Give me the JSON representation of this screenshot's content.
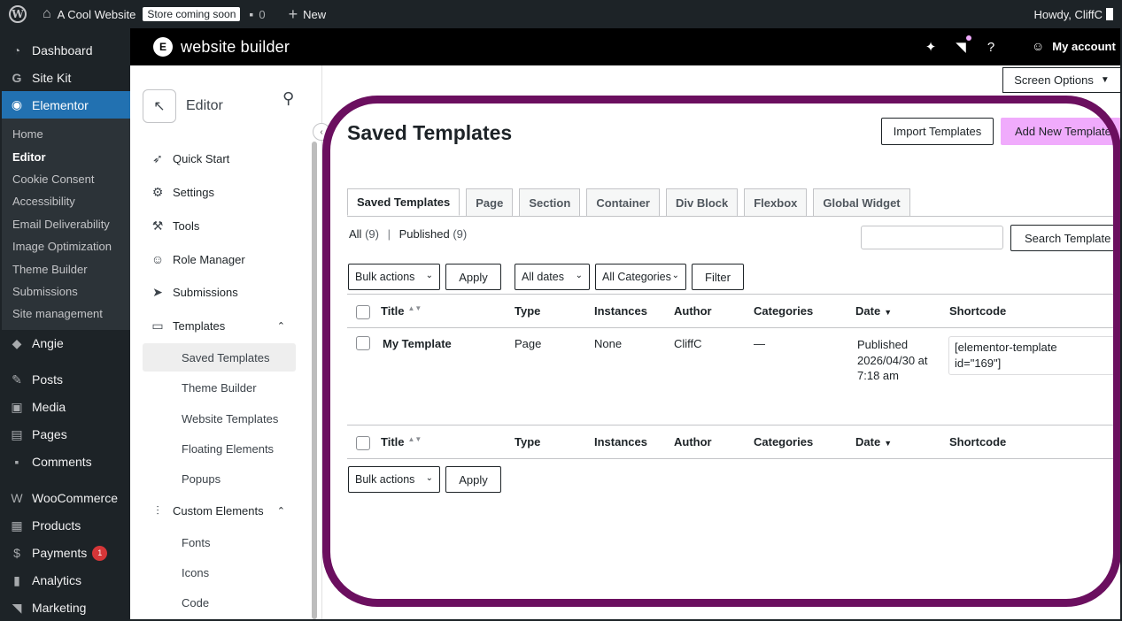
{
  "adminbar": {
    "site_name": "A Cool Website",
    "store_badge": "Store coming soon",
    "comments_count": "0",
    "new_label": "New",
    "howdy": "Howdy, CliffC"
  },
  "wpmenu": {
    "dashboard": "Dashboard",
    "sitekit": "Site Kit",
    "elementor": "Elementor",
    "elementor_sub": [
      "Home",
      "Editor",
      "Cookie Consent",
      "Accessibility",
      "Email Deliverability",
      "Image Optimization",
      "Theme Builder",
      "Submissions",
      "Site management"
    ],
    "angie": "Angie",
    "posts": "Posts",
    "media": "Media",
    "pages": "Pages",
    "comments": "Comments",
    "woocommerce": "WooCommerce",
    "products": "Products",
    "payments": "Payments",
    "payments_badge": "1",
    "analytics": "Analytics",
    "marketing": "Marketing"
  },
  "elheader": {
    "brand": "website builder",
    "my_account": "My account"
  },
  "elsidebar": {
    "title": "Editor",
    "quick_start": "Quick Start",
    "settings": "Settings",
    "tools": "Tools",
    "role_manager": "Role Manager",
    "submissions": "Submissions",
    "templates": "Templates",
    "templates_sub": [
      "Saved Templates",
      "Theme Builder",
      "Website Templates",
      "Floating Elements",
      "Popups"
    ],
    "custom_elements": "Custom Elements",
    "custom_sub": [
      "Fonts",
      "Icons",
      "Code"
    ]
  },
  "main": {
    "screen_options": "Screen Options",
    "page_title": "Saved Templates",
    "import_button": "Import Templates",
    "add_new_button": "Add New Template",
    "tabs": [
      "Saved Templates",
      "Page",
      "Section",
      "Container",
      "Div Block",
      "Flexbox",
      "Global Widget"
    ],
    "filter_all": "All",
    "filter_all_count": "(9)",
    "filter_sep": "|",
    "filter_published": "Published",
    "filter_published_count": "(9)",
    "search_button": "Search Template",
    "bulk_actions": "Bulk actions",
    "apply": "Apply",
    "all_dates": "All dates",
    "all_categories": "All Categories",
    "filter_button": "Filter",
    "columns": {
      "title": "Title",
      "type": "Type",
      "instances": "Instances",
      "author": "Author",
      "categories": "Categories",
      "date": "Date",
      "shortcode": "Shortcode"
    },
    "rows": [
      {
        "title": "My Template",
        "type": "Page",
        "instances": "None",
        "author": "CliffC",
        "categories": "—",
        "date_status": "Published",
        "date_value": "2026/04/30 at",
        "date_time": "7:18 am",
        "shortcode_line1": "[elementor-template",
        "shortcode_line2": "id=\"169\"]"
      }
    ]
  }
}
